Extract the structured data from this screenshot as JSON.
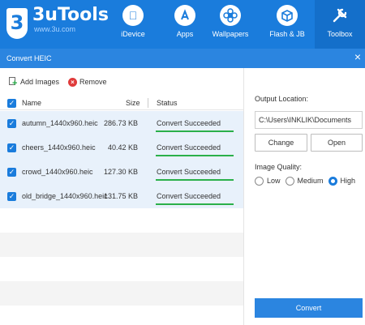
{
  "app": {
    "logo_glyph": "3",
    "title": "3uTools",
    "subtitle": "www.3u.com"
  },
  "nav": [
    {
      "label": "iDevice",
      "icon": "apple-icon",
      "glyph": ""
    },
    {
      "label": "Apps",
      "icon": "app-store-icon",
      "glyph": "A"
    },
    {
      "label": "Wallpapers",
      "icon": "flower-icon",
      "glyph": "✿"
    },
    {
      "label": "Flash & JB",
      "icon": "box-icon",
      "glyph": "❒"
    },
    {
      "label": "Toolbox",
      "icon": "tools-icon",
      "glyph": "⚒"
    }
  ],
  "dialog": {
    "title": "Convert HEIC",
    "close": "×"
  },
  "toolbar": {
    "add_label": "Add Images",
    "remove_label": "Remove"
  },
  "table": {
    "headers": {
      "name": "Name",
      "size": "Size",
      "status": "Status"
    },
    "rows": [
      {
        "name": "autumn_1440x960.heic",
        "size": "286.73 KB",
        "status": "Convert Succeeded"
      },
      {
        "name": "cheers_1440x960.heic",
        "size": "40.42 KB",
        "status": "Convert Succeeded"
      },
      {
        "name": "crowd_1440x960.heic",
        "size": "127.30 KB",
        "status": "Convert Succeeded"
      },
      {
        "name": "old_bridge_1440x960.heic",
        "size": "131.75 KB",
        "status": "Convert Succeeded"
      }
    ]
  },
  "output": {
    "label": "Output Location:",
    "path": "C:\\Users\\INKLIK\\Documents",
    "change_label": "Change",
    "open_label": "Open"
  },
  "quality": {
    "label": "Image Quality:",
    "options": [
      "Low",
      "Medium",
      "High"
    ],
    "selected": "High"
  },
  "convert_label": "Convert",
  "colors": {
    "brand": "#1a7cdc",
    "success": "#2bb04a",
    "danger": "#e03b3b",
    "row_bg": "#e8f1fb"
  }
}
